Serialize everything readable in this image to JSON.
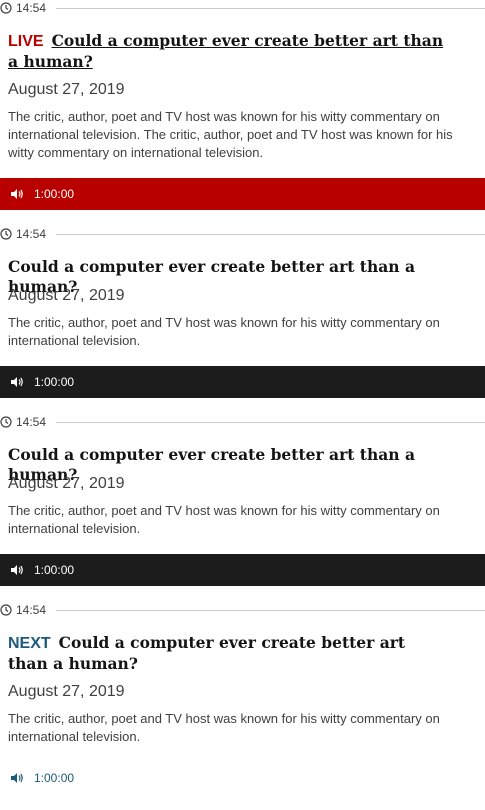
{
  "colors": {
    "live": "#b80000",
    "next": "#1e5a7b",
    "player_red": "#b80000",
    "player_dark": "#1c1c1c"
  },
  "entries": [
    {
      "time": "14:54",
      "tag": "LIVE",
      "headline": "Could a computer ever create better art than a human?",
      "date": "August 27, 2019",
      "summary": "The critic, author, poet and TV host was known for his witty commentary on international television. The critic, author, poet and TV host was known for his witty commentary on international television.",
      "duration": "1:00:00",
      "icon": "speaker-icon"
    },
    {
      "time": "14:54",
      "headline": "Could a computer ever create better art than a human?",
      "date": "August 27, 2019",
      "summary": "The critic, author, poet and TV host was known for his witty commentary on international television.",
      "duration": "1:00:00",
      "icon": "speaker-icon"
    },
    {
      "time": "14:54",
      "headline": "Could a computer ever create better art than a human?",
      "date": "August 27, 2019",
      "summary": "The critic, author, poet and TV host was known for his witty commentary on international television.",
      "duration": "1:00:00",
      "icon": "speaker-icon"
    },
    {
      "time": "14:54",
      "tag": "NEXT",
      "headline": "Could a computer ever create better art than a human?",
      "date": "August 27, 2019",
      "summary": "The critic, author, poet and TV host was known for his witty commentary on international television.",
      "duration": "1:00:00",
      "icon": "speaker-icon"
    }
  ]
}
